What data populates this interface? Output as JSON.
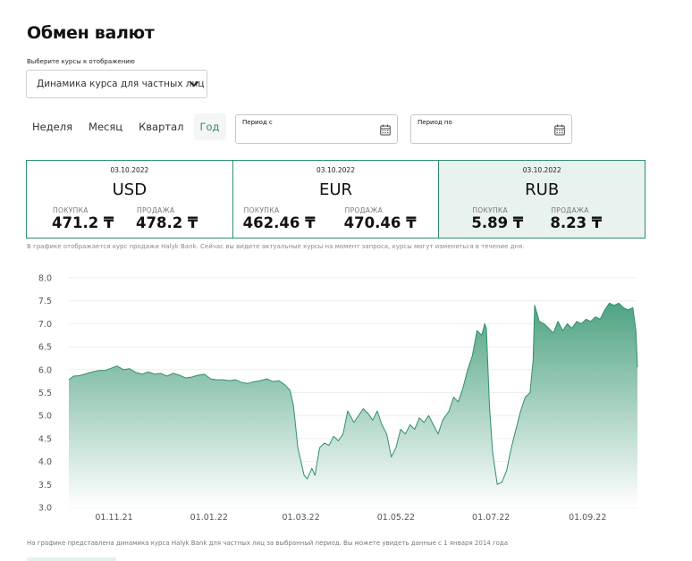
{
  "page": {
    "title": "Обмен валют",
    "select_label": "Выберите курсы к отображению",
    "select_value": "Динамика курса для частных лиц"
  },
  "tabs": [
    {
      "label": "Неделя",
      "active": false
    },
    {
      "label": "Месяц",
      "active": false
    },
    {
      "label": "Квартал",
      "active": false
    },
    {
      "label": "Год",
      "active": true
    }
  ],
  "period": {
    "from_label": "Период с",
    "to_label": "Период по"
  },
  "rates": [
    {
      "date": "03.10.2022",
      "currency": "USD",
      "buy_label": "ПОКУПКА",
      "buy": "471.2 ₸",
      "sell_label": "ПРОДАЖА",
      "sell": "478.2 ₸"
    },
    {
      "date": "03.10.2022",
      "currency": "EUR",
      "buy_label": "ПОКУПКА",
      "buy": "462.46 ₸",
      "sell_label": "ПРОДАЖА",
      "sell": "470.46 ₸"
    },
    {
      "date": "03.10.2022",
      "currency": "RUB",
      "buy_label": "ПОКУПКА",
      "buy": "5.89 ₸",
      "sell_label": "ПРОДАЖА",
      "sell": "8.23 ₸"
    }
  ],
  "notes": {
    "rates_note": "В графике отображается курс продажи Halyk Bank. Сейчас вы видите актуальные курсы на момент запроса, курсы могут изменяться в течение дня.",
    "chart_note": "На графике представлена динамика курса Halyk Bank для частных лиц за выбранный период. Вы можете увидеть данные с 1 января 2014 года"
  },
  "colors": {
    "accent": "#2f8f6b",
    "fill_top": "#4fa382",
    "fill_bottom": "#ffffff"
  },
  "icons": {
    "select": "chevron-down-icon",
    "period": "calendar-icon"
  },
  "chart_data": {
    "type": "area",
    "title": "",
    "xlabel": "",
    "ylabel": "",
    "ylim": [
      3.0,
      8.0
    ],
    "yticks": [
      "8.0",
      "7.5",
      "7.0",
      "6.5",
      "6.0",
      "5.5",
      "5.0",
      "4.5",
      "4.0",
      "3.5",
      "3.0"
    ],
    "xticks": [
      {
        "label": "01.11.21",
        "x": "2021-11-01"
      },
      {
        "label": "01.01.22",
        "x": "2022-01-01"
      },
      {
        "label": "01.03.22",
        "x": "2022-03-01"
      },
      {
        "label": "01.05.22",
        "x": "2022-05-01"
      },
      {
        "label": "01.07.22",
        "x": "2022-07-01"
      },
      {
        "label": "01.09.22",
        "x": "2022-09-01"
      }
    ],
    "x_range": [
      "2021-10-03",
      "2022-10-03"
    ],
    "grid": "horizontal",
    "series": [
      {
        "points": [
          [
            "2021-10-03",
            5.78
          ],
          [
            "2021-10-06",
            5.86
          ],
          [
            "2021-10-10",
            5.87
          ],
          [
            "2021-10-14",
            5.91
          ],
          [
            "2021-10-18",
            5.95
          ],
          [
            "2021-10-22",
            5.98
          ],
          [
            "2021-10-26",
            5.98
          ],
          [
            "2021-10-30",
            6.03
          ],
          [
            "2021-11-03",
            6.08
          ],
          [
            "2021-11-07",
            6.0
          ],
          [
            "2021-11-11",
            6.02
          ],
          [
            "2021-11-15",
            5.94
          ],
          [
            "2021-11-19",
            5.9
          ],
          [
            "2021-11-23",
            5.95
          ],
          [
            "2021-11-27",
            5.9
          ],
          [
            "2021-12-01",
            5.92
          ],
          [
            "2021-12-05",
            5.86
          ],
          [
            "2021-12-09",
            5.92
          ],
          [
            "2021-12-13",
            5.88
          ],
          [
            "2021-12-17",
            5.82
          ],
          [
            "2021-12-21",
            5.84
          ],
          [
            "2021-12-25",
            5.88
          ],
          [
            "2021-12-29",
            5.9
          ],
          [
            "2022-01-02",
            5.8
          ],
          [
            "2022-01-06",
            5.78
          ],
          [
            "2022-01-10",
            5.78
          ],
          [
            "2022-01-14",
            5.76
          ],
          [
            "2022-01-18",
            5.78
          ],
          [
            "2022-01-22",
            5.72
          ],
          [
            "2022-01-26",
            5.7
          ],
          [
            "2022-01-30",
            5.74
          ],
          [
            "2022-02-03",
            5.76
          ],
          [
            "2022-02-07",
            5.8
          ],
          [
            "2022-02-11",
            5.74
          ],
          [
            "2022-02-15",
            5.76
          ],
          [
            "2022-02-19",
            5.66
          ],
          [
            "2022-02-22",
            5.55
          ],
          [
            "2022-02-24",
            5.25
          ],
          [
            "2022-02-25",
            4.95
          ],
          [
            "2022-02-27",
            4.3
          ],
          [
            "2022-03-01",
            4.0
          ],
          [
            "2022-03-03",
            3.7
          ],
          [
            "2022-03-05",
            3.62
          ],
          [
            "2022-03-08",
            3.85
          ],
          [
            "2022-03-10",
            3.7
          ],
          [
            "2022-03-13",
            4.3
          ],
          [
            "2022-03-16",
            4.4
          ],
          [
            "2022-03-19",
            4.35
          ],
          [
            "2022-03-22",
            4.55
          ],
          [
            "2022-03-25",
            4.45
          ],
          [
            "2022-03-28",
            4.6
          ],
          [
            "2022-03-31",
            5.1
          ],
          [
            "2022-04-04",
            4.85
          ],
          [
            "2022-04-07",
            5.0
          ],
          [
            "2022-04-10",
            5.15
          ],
          [
            "2022-04-13",
            5.05
          ],
          [
            "2022-04-16",
            4.9
          ],
          [
            "2022-04-19",
            5.1
          ],
          [
            "2022-04-22",
            4.8
          ],
          [
            "2022-04-25",
            4.6
          ],
          [
            "2022-04-28",
            4.1
          ],
          [
            "2022-05-01",
            4.3
          ],
          [
            "2022-05-04",
            4.7
          ],
          [
            "2022-05-07",
            4.6
          ],
          [
            "2022-05-10",
            4.8
          ],
          [
            "2022-05-13",
            4.7
          ],
          [
            "2022-05-16",
            4.95
          ],
          [
            "2022-05-19",
            4.85
          ],
          [
            "2022-05-22",
            5.0
          ],
          [
            "2022-05-25",
            4.8
          ],
          [
            "2022-05-28",
            4.6
          ],
          [
            "2022-05-31",
            4.9
          ],
          [
            "2022-06-04",
            5.1
          ],
          [
            "2022-06-07",
            5.4
          ],
          [
            "2022-06-10",
            5.3
          ],
          [
            "2022-06-13",
            5.6
          ],
          [
            "2022-06-16",
            6.0
          ],
          [
            "2022-06-19",
            6.3
          ],
          [
            "2022-06-22",
            6.85
          ],
          [
            "2022-06-25",
            6.75
          ],
          [
            "2022-06-27",
            7.0
          ],
          [
            "2022-06-28",
            6.9
          ],
          [
            "2022-06-30",
            5.2
          ],
          [
            "2022-07-02",
            4.2
          ],
          [
            "2022-07-05",
            3.5
          ],
          [
            "2022-07-08",
            3.55
          ],
          [
            "2022-07-11",
            3.8
          ],
          [
            "2022-07-14",
            4.3
          ],
          [
            "2022-07-17",
            4.7
          ],
          [
            "2022-07-20",
            5.1
          ],
          [
            "2022-07-23",
            5.4
          ],
          [
            "2022-07-26",
            5.5
          ],
          [
            "2022-07-28",
            6.2
          ],
          [
            "2022-07-29",
            7.4
          ],
          [
            "2022-08-01",
            7.05
          ],
          [
            "2022-08-04",
            7.0
          ],
          [
            "2022-08-07",
            6.9
          ],
          [
            "2022-08-10",
            6.8
          ],
          [
            "2022-08-13",
            7.05
          ],
          [
            "2022-08-16",
            6.85
          ],
          [
            "2022-08-19",
            7.0
          ],
          [
            "2022-08-22",
            6.9
          ],
          [
            "2022-08-25",
            7.05
          ],
          [
            "2022-08-28",
            7.0
          ],
          [
            "2022-08-31",
            7.1
          ],
          [
            "2022-09-03",
            7.05
          ],
          [
            "2022-09-06",
            7.15
          ],
          [
            "2022-09-09",
            7.1
          ],
          [
            "2022-09-12",
            7.3
          ],
          [
            "2022-09-15",
            7.45
          ],
          [
            "2022-09-18",
            7.4
          ],
          [
            "2022-09-21",
            7.45
          ],
          [
            "2022-09-24",
            7.35
          ],
          [
            "2022-09-27",
            7.3
          ],
          [
            "2022-09-30",
            7.35
          ],
          [
            "2022-10-02",
            6.85
          ],
          [
            "2022-10-03",
            6.05
          ]
        ]
      }
    ]
  }
}
